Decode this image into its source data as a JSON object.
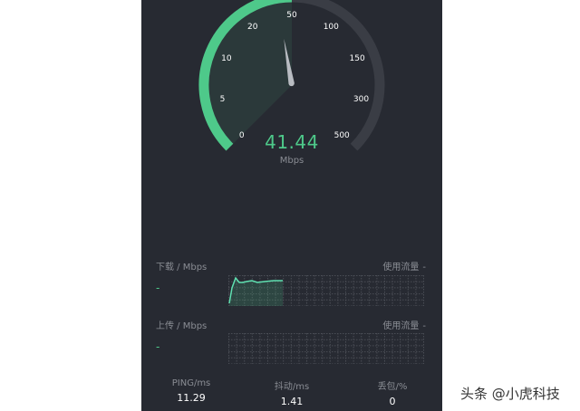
{
  "gauge": {
    "ticks": [
      "0",
      "5",
      "10",
      "20",
      "50",
      "100",
      "150",
      "300",
      "500"
    ],
    "value": "41.44",
    "unit": "Mbps",
    "active_color": "#4ec98a",
    "track_color": "#3a3d45",
    "needle_color": "#b9bcc2"
  },
  "download": {
    "label": "下载 / Mbps",
    "usage_label": "使用流量",
    "usage_value": "-",
    "value": "-"
  },
  "upload": {
    "label": "上传 / Mbps",
    "usage_label": "使用流量",
    "usage_value": "-",
    "value": "-"
  },
  "stats": {
    "ping": {
      "label": "PING/ms",
      "value": "11.29"
    },
    "jitter": {
      "label": "抖动/ms",
      "value": "1.41"
    },
    "loss": {
      "label": "丢包/%",
      "value": "0"
    }
  },
  "watermark": "头条 @小虎科技"
}
